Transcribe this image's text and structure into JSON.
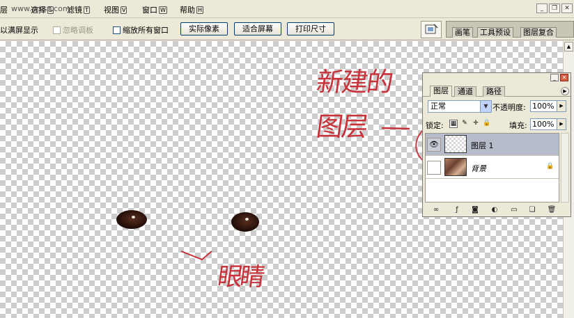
{
  "menubar": {
    "items": [
      {
        "label": "层",
        "key": ""
      },
      {
        "label": "选择",
        "key": "S"
      },
      {
        "label": "滤镜",
        "key": "T"
      },
      {
        "label": "视图",
        "key": "V"
      },
      {
        "label": "窗口",
        "key": "W"
      },
      {
        "label": "帮助",
        "key": "H"
      }
    ],
    "overlay_text": "www.crssc.com",
    "window_controls": {
      "minimize": "_",
      "restore": "❐",
      "close": "✕"
    }
  },
  "options_bar": {
    "fit_window_label": "以满屏显示",
    "ignore_palettes_label": "忽略调板",
    "zoom_all_windows_label": "缩放所有窗口",
    "actual_pixels_label": "实际像素",
    "fit_screen_label": "适合屏幕",
    "print_size_label": "打印尺寸"
  },
  "palette_well": {
    "tabs": [
      "画笔",
      "工具预设",
      "图层复合"
    ]
  },
  "annotations": {
    "new_layer_line1": "新建的",
    "new_layer_line2": "图层",
    "eyes_label": "眼睛"
  },
  "layers_panel": {
    "tabs": [
      "图层",
      "通道",
      "路径"
    ],
    "active_tab": "图层",
    "blend_mode": "正常",
    "opacity_label": "不透明度:",
    "opacity_value": "100%",
    "lock_label": "锁定:",
    "fill_label": "填充:",
    "fill_value": "100%",
    "layers": [
      {
        "name": "图层 1",
        "visible": true,
        "selected": true
      },
      {
        "name": "背景",
        "visible": false,
        "selected": false,
        "locked": true
      }
    ]
  },
  "colors": {
    "annotation_red": "#c8323a",
    "selected_layer": "#b7bccb"
  }
}
